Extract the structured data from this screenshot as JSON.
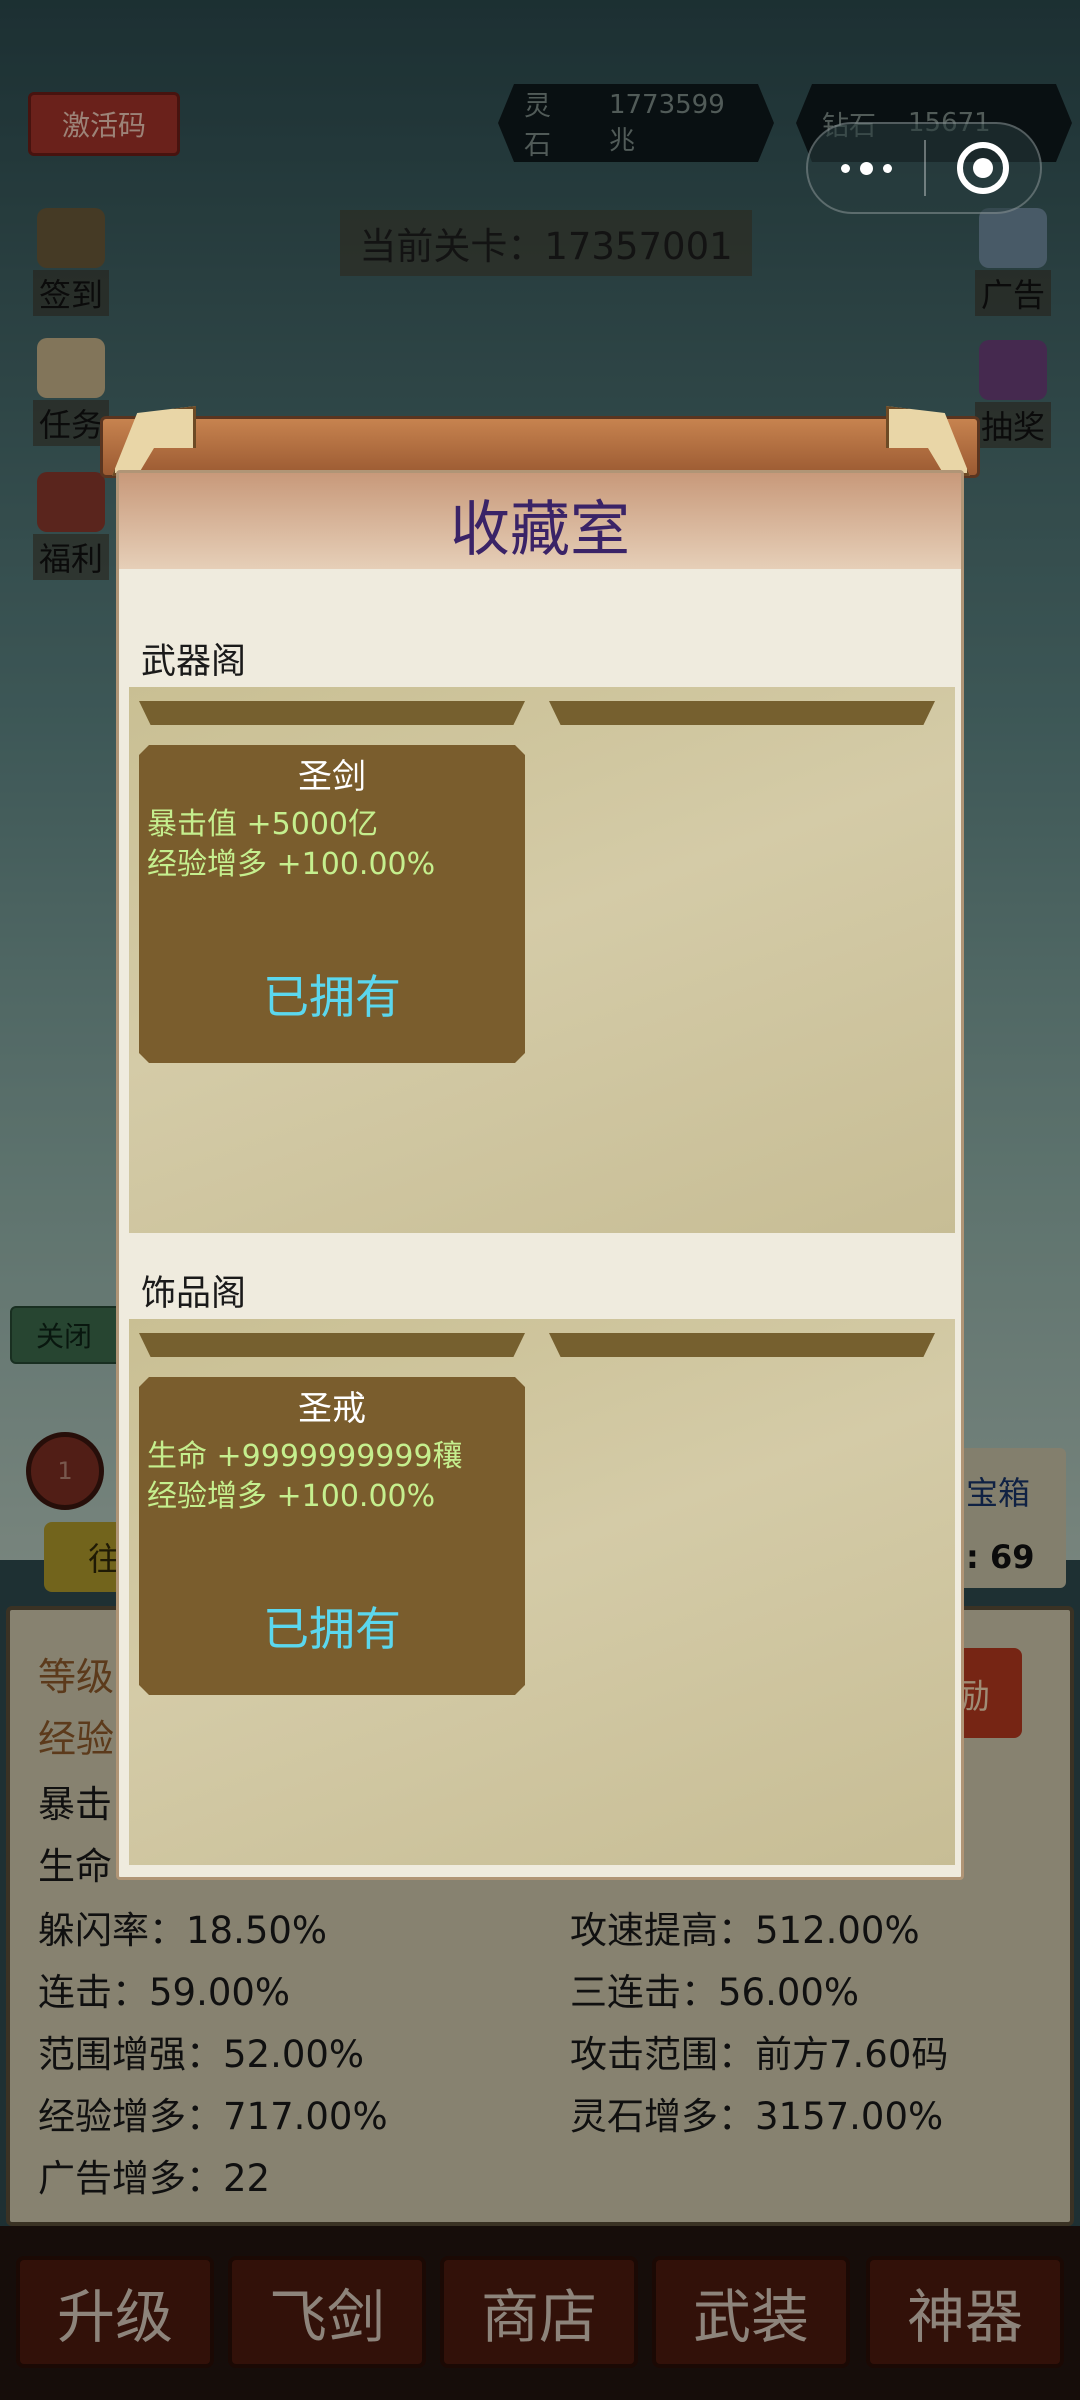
{
  "topbar": {
    "activation_code": "激活码",
    "spirit_stone_label": "灵石",
    "spirit_stone_value": "1773599兆",
    "diamond_label": "钻石",
    "diamond_value": "15671",
    "current_stage": "当前关卡：17357001"
  },
  "side_left": [
    "签到",
    "任务",
    "福利"
  ],
  "side_right": [
    "广告",
    "抽奖"
  ],
  "background_fragments": {
    "close_button": "关闭",
    "round_badge": "1",
    "go_button": "往",
    "chest_label": "宝箱",
    "chest_count": ": 69",
    "reward_button": "励"
  },
  "modal": {
    "title": "收藏室",
    "weapons": {
      "section_title": "武器阁",
      "item": {
        "name": "圣剑",
        "stats": [
          "暴击值 +5000亿",
          "经验增多 +100.00%"
        ],
        "status": "已拥有"
      }
    },
    "accessories": {
      "section_title": "饰品阁",
      "item": {
        "name": "圣戒",
        "stats": [
          "生命 +9999999999穰",
          "经验增多 +100.00%"
        ],
        "status": "已拥有"
      }
    }
  },
  "stats_panel": {
    "level_label": "等级",
    "exp_label": "经验",
    "crit_label": "暴击",
    "hp_label": "生命",
    "rows": [
      [
        "躲闪率：18.50%",
        "攻速提高：512.00%"
      ],
      [
        "连击：59.00%",
        "三连击：56.00%"
      ],
      [
        "范围增强：52.00%",
        "攻击范围：前方7.60码"
      ],
      [
        "经验增多：717.00%",
        "灵石增多：3157.00%"
      ],
      [
        "广告增多：22",
        ""
      ]
    ]
  },
  "bottom_nav": [
    "升级",
    "飞剑",
    "商店",
    "武装",
    "神器"
  ]
}
